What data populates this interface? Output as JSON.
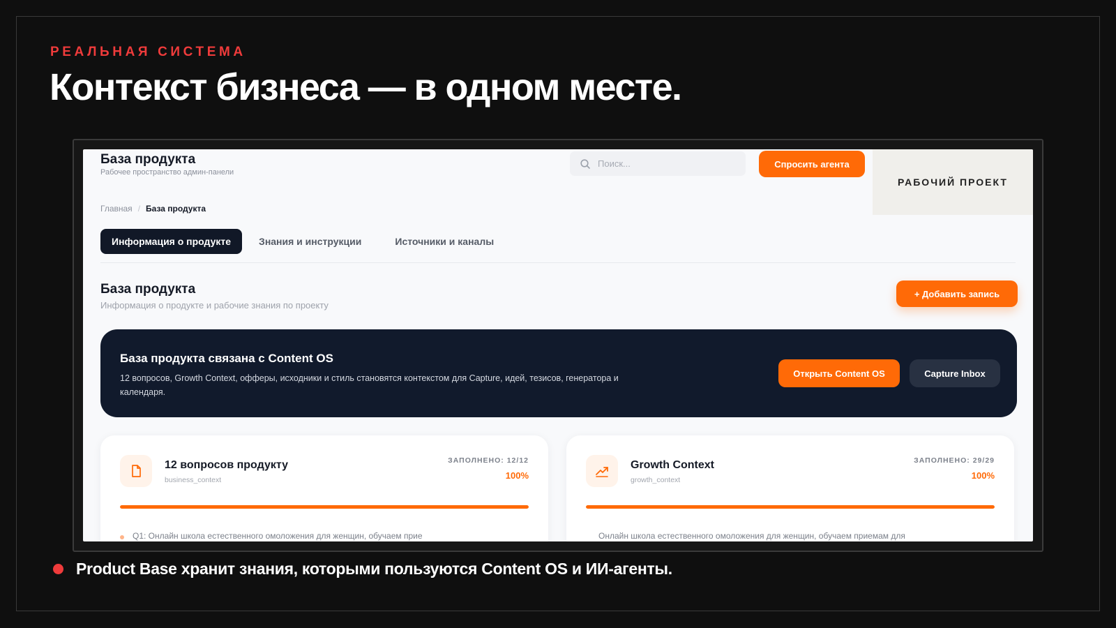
{
  "slide": {
    "eyebrow": "РЕАЛЬНАЯ СИСТЕМА",
    "headline": "Контекст бизнеса — в одном месте.",
    "bullet": "Product Base хранит знания, которыми пользуются Content OS и ИИ-агенты.",
    "accent_color": "#ef3b3b"
  },
  "app": {
    "header": {
      "title": "База продукта",
      "subtitle": "Рабочее пространство админ-панели",
      "search_placeholder": "Поиск...",
      "ask_button": "Спросить агента",
      "project_label": "РАБОЧИЙ ПРОЕКТ"
    },
    "breadcrumb": {
      "home": "Главная",
      "separator": "/",
      "current": "База продукта"
    },
    "tabs": [
      {
        "label": "Информация о продукте",
        "active": true
      },
      {
        "label": "Знания и инструкции",
        "active": false
      },
      {
        "label": "Источники и каналы",
        "active": false
      }
    ],
    "section": {
      "title": "База продукта",
      "subtitle": "Информация о продукте и рабочие знания по проекту",
      "add_button": "+ Добавить запись"
    },
    "banner": {
      "title": "База продукта связана с Content OS",
      "text": "12 вопросов, Growth Context, офферы, исходники и стиль становятся контекстом для Capture, идей, тезисов, генератора и календаря.",
      "open_button": "Открыть Content OS",
      "inbox_button": "Capture Inbox"
    },
    "cards": [
      {
        "icon": "document-icon",
        "title": "12 вопросов продукту",
        "key": "business_context",
        "filled": "ЗАПОЛНЕНО: 12/12",
        "percent": "100%",
        "progress": 1.0,
        "preview": "Q1: Онлайн школа естественного омоложения для женщин, обучаем прие"
      },
      {
        "icon": "trending-up-icon",
        "title": "Growth Context",
        "key": "growth_context",
        "filled": "ЗАПОЛНЕНО: 29/29",
        "percent": "100%",
        "progress": 1.0,
        "preview": "Онлайн школа естественного омоложения для женщин, обучаем приемам для"
      }
    ],
    "accent_color": "#ff6a07",
    "dark_color": "#111a2c"
  }
}
